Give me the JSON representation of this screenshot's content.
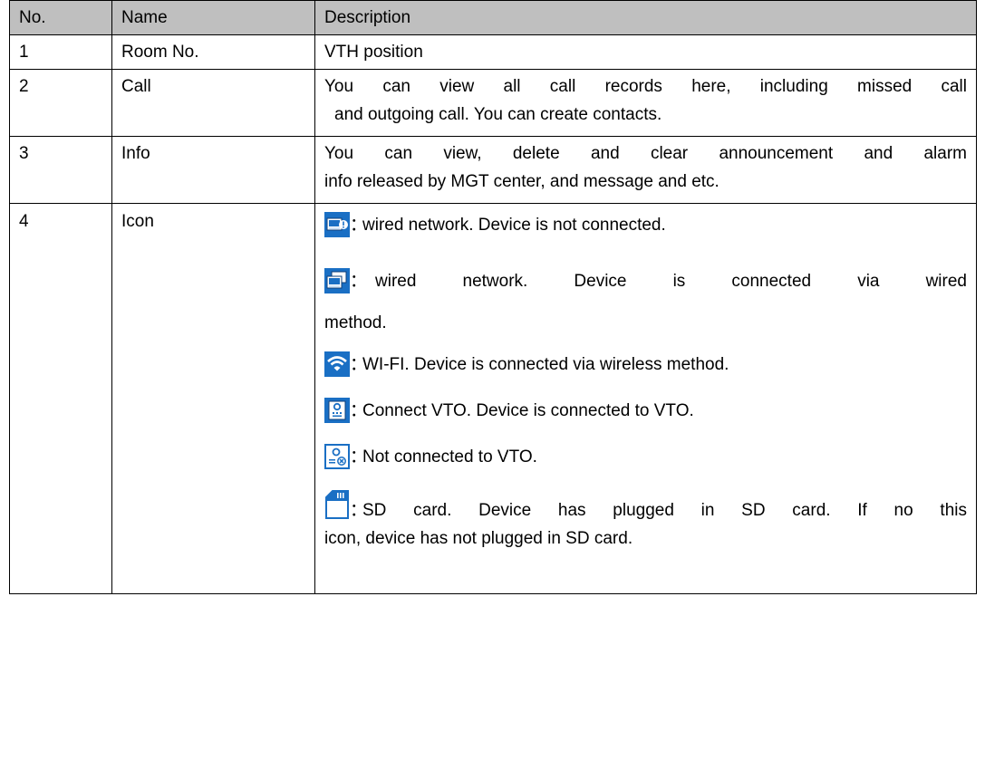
{
  "headers": [
    "No.",
    "Name",
    "Description"
  ],
  "rows": [
    {
      "no": "1",
      "name": "Room No.",
      "desc": "VTH position"
    },
    {
      "no": "2",
      "name": "Call",
      "desc_l1": "You can view all call records here, including missed call",
      "desc_l2": "and outgoing call. You can create contacts."
    },
    {
      "no": "3",
      "name": "Info",
      "desc_l1": "You can view, delete and clear announcement and alarm",
      "desc_l2": "info released by MGT center, and message and etc."
    },
    {
      "no": "4",
      "name": "Icon"
    }
  ],
  "icons": [
    {
      "icon": "wired-network-disconnected-icon",
      "text": "wired network. Device is not connected."
    },
    {
      "icon": "wired-network-connected-icon",
      "text_l1": "wired network. Device is connected via wired",
      "text_l2": "method."
    },
    {
      "icon": "wifi-icon",
      "text": "WI-FI. Device is connected via wireless method."
    },
    {
      "icon": "vto-connected-icon",
      "text": "Connect VTO. Device is connected to VTO."
    },
    {
      "icon": "vto-disconnected-icon",
      "text": "Not connected to VTO."
    },
    {
      "icon": "sd-card-icon",
      "text_l1": "SD card. Device has plugged in SD card. If no this",
      "text_l2": "icon, device has not plugged in SD card."
    }
  ],
  "colon": "："
}
